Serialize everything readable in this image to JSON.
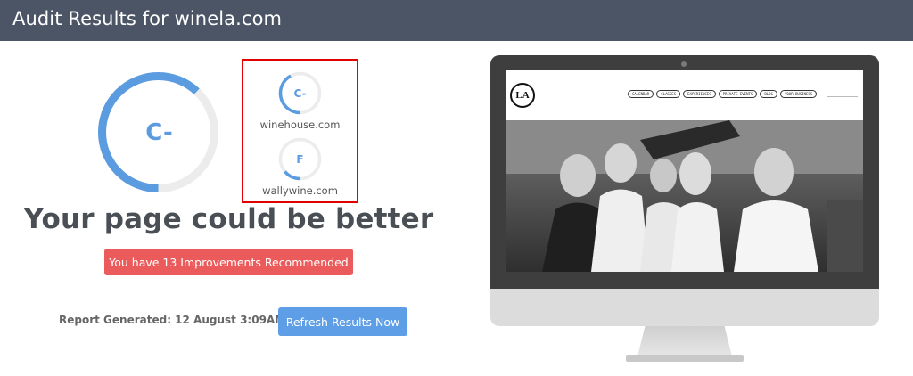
{
  "header": {
    "title": "Audit Results for winela.com"
  },
  "main_grade": {
    "grade": "C-",
    "score_fraction": 0.62
  },
  "competitors": [
    {
      "grade": "C-",
      "domain": "winehouse.com",
      "score_fraction": 0.42
    },
    {
      "grade": "F",
      "domain": "wallywine.com",
      "score_fraction": 0.14
    }
  ],
  "headline": "Your page could be better",
  "improvements_badge": "You have 13 Improvements Recommended",
  "report": {
    "generated": "Report Generated: 12 August 3:09AM"
  },
  "refresh_button": "Refresh Results Now",
  "preview_site": {
    "logo": "LA",
    "menu": [
      "CALENDAR",
      "CLASSES",
      "EXPERIENCES",
      "PRIVATE EVENTS",
      "BLOG",
      "YOUR BUSINESS"
    ]
  },
  "colors": {
    "header_bg": "#4c5566",
    "gauge_accent": "#5b9be0",
    "gauge_track": "#ececec",
    "badge_red": "#ec5b5b",
    "button_blue": "#5d9ee6",
    "highlight_border": "#e00000"
  }
}
